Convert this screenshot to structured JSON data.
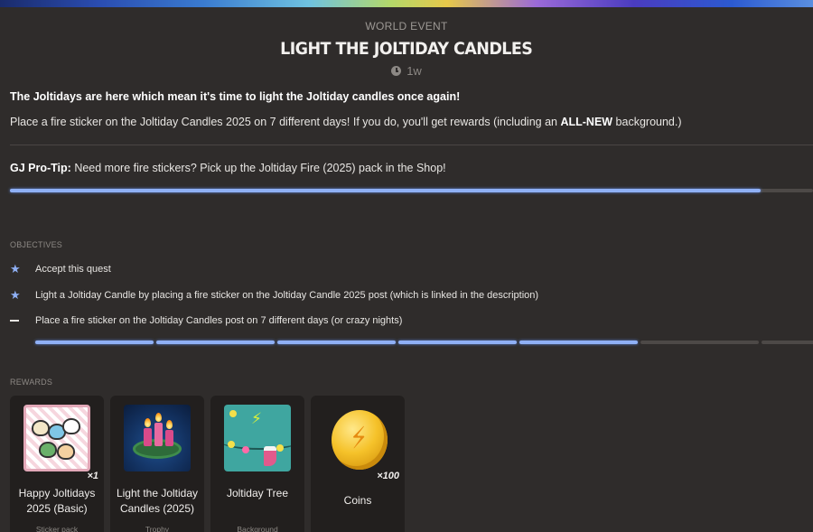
{
  "header": {
    "kind": "WORLD EVENT",
    "title": "LIGHT THE JOLTIDAY CANDLES",
    "time": "1w"
  },
  "description": {
    "headline": "The Joltidays are here which mean it's time to light the Joltiday candles once again!",
    "body_prefix": "Place a fire sticker on the Joltiday Candles 2025 on 7 different days!  If you do, you'll get rewards (including an ",
    "body_emphasis": "ALL-NEW",
    "body_suffix": " background.)",
    "tip_label": "GJ Pro-Tip:",
    "tip_text": " Need more fire stickers? Pick up the Joltiday Fire (2025) pack in the Shop!"
  },
  "overall_progress": {
    "fraction": 0.935,
    "color": "#8fb0f5"
  },
  "objectives": {
    "label": "OBJECTIVES",
    "items": [
      {
        "text": "Accept this quest",
        "status": "complete",
        "icon": "star-icon"
      },
      {
        "text": "Light a Joltiday Candle by placing a fire sticker on the Joltiday Candle 2025 post (which is linked in the description)",
        "status": "complete",
        "icon": "star-icon"
      },
      {
        "text": "Place a fire sticker on the Joltiday Candles post on 7 different days (or crazy nights)",
        "status": "in-progress",
        "icon": "dash-icon"
      }
    ],
    "segments_total": 7,
    "segments_done": 5
  },
  "rewards": {
    "label": "REWARDS",
    "items": [
      {
        "name": "Happy Joltidays 2025 (Basic)",
        "type": "Sticker pack",
        "quantity": "×1"
      },
      {
        "name": "Light the Joltiday Candles (2025)",
        "type": "Trophy",
        "quantity": ""
      },
      {
        "name": "Joltiday Tree",
        "type": "Background",
        "quantity": ""
      },
      {
        "name": "Coins",
        "type": "",
        "quantity": "×100"
      }
    ]
  }
}
